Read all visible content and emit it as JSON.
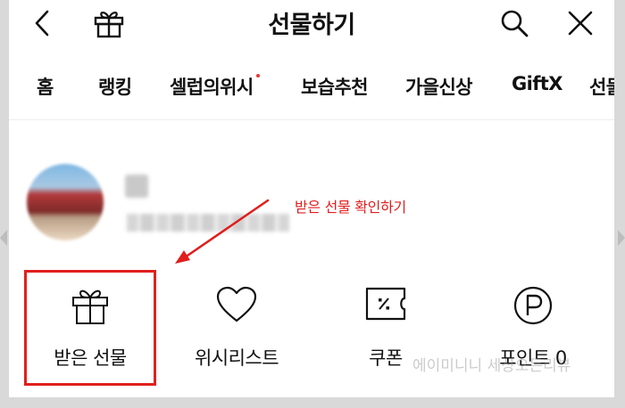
{
  "header": {
    "title": "선물하기",
    "back_icon": "chevron-left-icon",
    "gift_icon": "gift-icon",
    "search_icon": "search-icon",
    "close_icon": "close-icon"
  },
  "tabs": [
    {
      "label": "홈"
    },
    {
      "label": "랭킹"
    },
    {
      "label": "셀럽의위시",
      "new_dot": true
    },
    {
      "label": "보습추천"
    },
    {
      "label": "가을신상"
    },
    {
      "label": "GiftX"
    },
    {
      "label": "선물"
    }
  ],
  "annotation": {
    "text": "받은 선물 확인하기",
    "color": "#e11d1d"
  },
  "menu": [
    {
      "label": "받은 선물",
      "icon": "gift-icon"
    },
    {
      "label": "위시리스트",
      "icon": "heart-icon"
    },
    {
      "label": "쿠폰",
      "icon": "coupon-icon"
    },
    {
      "label": "포인트",
      "value": "0",
      "icon": "point-icon"
    }
  ],
  "watermark": "에이미니니 세상오든리뷰",
  "colors": {
    "highlight": "#e0201d",
    "new_dot": "#e53935"
  }
}
